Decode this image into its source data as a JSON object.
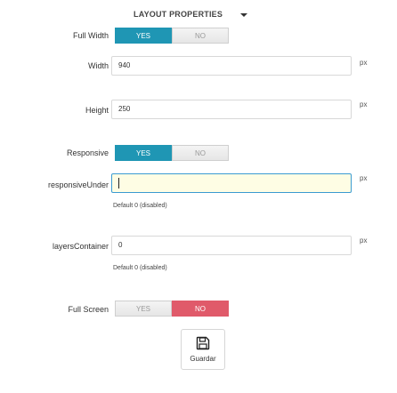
{
  "header": {
    "title": "LAYOUT PROPERTIES",
    "toggle_icon": "chevron-down-icon"
  },
  "full_width": {
    "label": "Full Width",
    "yes": "YES",
    "no": "NO",
    "selected": "YES"
  },
  "width": {
    "label": "Width",
    "value": "940",
    "unit": "px"
  },
  "height": {
    "label": "Height",
    "value": "250",
    "unit": "px"
  },
  "responsive": {
    "label": "Responsive",
    "yes": "YES",
    "no": "NO",
    "selected": "YES"
  },
  "responsive_under": {
    "label": "responsiveUnder",
    "value": "",
    "unit": "px",
    "help": "Default 0 (disabled)"
  },
  "layers_container": {
    "label": "layersContainer",
    "value": "0",
    "unit": "px",
    "help": "Default 0 (disabled)"
  },
  "full_screen": {
    "label": "Full Screen",
    "yes": "YES",
    "no": "NO",
    "selected": "NO"
  },
  "save": {
    "label": "Guardar",
    "icon": "floppy-disk-icon"
  },
  "colors": {
    "yes_active": "#1f96b4",
    "no_active": "#e05a6a",
    "focus_bg": "#fefde4",
    "focus_border": "#3a9bd1"
  }
}
